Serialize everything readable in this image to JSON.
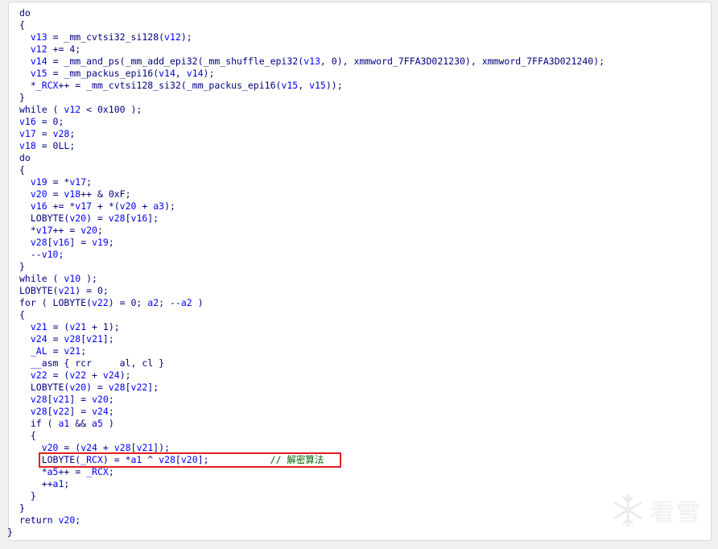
{
  "colors": {
    "keyword": "#000080",
    "variable": "#0000ff",
    "comment": "#006400",
    "highlight_border": "#e02020"
  },
  "code_lines": [
    [
      {
        "t": "do",
        "c": "k"
      }
    ],
    [
      {
        "t": "{",
        "c": "k"
      }
    ],
    [
      {
        "t": "  ",
        "c": "k"
      },
      {
        "t": "v13",
        "c": "v"
      },
      {
        "t": " = _mm_cvtsi32_si128(",
        "c": "k"
      },
      {
        "t": "v12",
        "c": "v"
      },
      {
        "t": ");",
        "c": "k"
      }
    ],
    [
      {
        "t": "  ",
        "c": "k"
      },
      {
        "t": "v12",
        "c": "v"
      },
      {
        "t": " += 4;",
        "c": "k"
      }
    ],
    [
      {
        "t": "  ",
        "c": "k"
      },
      {
        "t": "v14",
        "c": "v"
      },
      {
        "t": " = _mm_and_ps(_mm_add_epi32(_mm_shuffle_epi32(",
        "c": "k"
      },
      {
        "t": "v13",
        "c": "v"
      },
      {
        "t": ", 0), xmmword_7FFA3D021230), xmmword_7FFA3D021240);",
        "c": "k"
      }
    ],
    [
      {
        "t": "  ",
        "c": "k"
      },
      {
        "t": "v15",
        "c": "v"
      },
      {
        "t": " = _mm_packus_epi16(",
        "c": "k"
      },
      {
        "t": "v14",
        "c": "v"
      },
      {
        "t": ", ",
        "c": "k"
      },
      {
        "t": "v14",
        "c": "v"
      },
      {
        "t": ");",
        "c": "k"
      }
    ],
    [
      {
        "t": "  *",
        "c": "k"
      },
      {
        "t": "_RCX",
        "c": "v"
      },
      {
        "t": "++ = _mm_cvtsi128_si32(_mm_packus_epi16(",
        "c": "k"
      },
      {
        "t": "v15",
        "c": "v"
      },
      {
        "t": ", ",
        "c": "k"
      },
      {
        "t": "v15",
        "c": "v"
      },
      {
        "t": "));",
        "c": "k"
      }
    ],
    [
      {
        "t": "}",
        "c": "k"
      }
    ],
    [
      {
        "t": "while ( ",
        "c": "k"
      },
      {
        "t": "v12",
        "c": "v"
      },
      {
        "t": " < 0x100 );",
        "c": "k"
      }
    ],
    [
      {
        "t": "v16",
        "c": "v"
      },
      {
        "t": " = 0;",
        "c": "k"
      }
    ],
    [
      {
        "t": "v17",
        "c": "v"
      },
      {
        "t": " = ",
        "c": "k"
      },
      {
        "t": "v28",
        "c": "v"
      },
      {
        "t": ";",
        "c": "k"
      }
    ],
    [
      {
        "t": "v18",
        "c": "v"
      },
      {
        "t": " = 0LL;",
        "c": "k"
      }
    ],
    [
      {
        "t": "do",
        "c": "k"
      }
    ],
    [
      {
        "t": "{",
        "c": "k"
      }
    ],
    [
      {
        "t": "  ",
        "c": "k"
      },
      {
        "t": "v19",
        "c": "v"
      },
      {
        "t": " = *",
        "c": "k"
      },
      {
        "t": "v17",
        "c": "v"
      },
      {
        "t": ";",
        "c": "k"
      }
    ],
    [
      {
        "t": "  ",
        "c": "k"
      },
      {
        "t": "v20",
        "c": "v"
      },
      {
        "t": " = ",
        "c": "k"
      },
      {
        "t": "v18",
        "c": "v"
      },
      {
        "t": "++ & 0xF;",
        "c": "k"
      }
    ],
    [
      {
        "t": "  ",
        "c": "k"
      },
      {
        "t": "v16",
        "c": "v"
      },
      {
        "t": " += *",
        "c": "k"
      },
      {
        "t": "v17",
        "c": "v"
      },
      {
        "t": " + *(",
        "c": "k"
      },
      {
        "t": "v20",
        "c": "v"
      },
      {
        "t": " + ",
        "c": "k"
      },
      {
        "t": "a3",
        "c": "v"
      },
      {
        "t": ");",
        "c": "k"
      }
    ],
    [
      {
        "t": "  LOBYTE(",
        "c": "k"
      },
      {
        "t": "v20",
        "c": "v"
      },
      {
        "t": ") = ",
        "c": "k"
      },
      {
        "t": "v28",
        "c": "v"
      },
      {
        "t": "[",
        "c": "k"
      },
      {
        "t": "v16",
        "c": "v"
      },
      {
        "t": "];",
        "c": "k"
      }
    ],
    [
      {
        "t": "  *",
        "c": "k"
      },
      {
        "t": "v17",
        "c": "v"
      },
      {
        "t": "++ = ",
        "c": "k"
      },
      {
        "t": "v20",
        "c": "v"
      },
      {
        "t": ";",
        "c": "k"
      }
    ],
    [
      {
        "t": "  ",
        "c": "k"
      },
      {
        "t": "v28",
        "c": "v"
      },
      {
        "t": "[",
        "c": "k"
      },
      {
        "t": "v16",
        "c": "v"
      },
      {
        "t": "] = ",
        "c": "k"
      },
      {
        "t": "v19",
        "c": "v"
      },
      {
        "t": ";",
        "c": "k"
      }
    ],
    [
      {
        "t": "  --",
        "c": "k"
      },
      {
        "t": "v10",
        "c": "v"
      },
      {
        "t": ";",
        "c": "k"
      }
    ],
    [
      {
        "t": "}",
        "c": "k"
      }
    ],
    [
      {
        "t": "while ( ",
        "c": "k"
      },
      {
        "t": "v10",
        "c": "v"
      },
      {
        "t": " );",
        "c": "k"
      }
    ],
    [
      {
        "t": "LOBYTE(",
        "c": "k"
      },
      {
        "t": "v21",
        "c": "v"
      },
      {
        "t": ") = 0;",
        "c": "k"
      }
    ],
    [
      {
        "t": "for ( LOBYTE(",
        "c": "k"
      },
      {
        "t": "v22",
        "c": "v"
      },
      {
        "t": ") = 0; ",
        "c": "k"
      },
      {
        "t": "a2",
        "c": "v"
      },
      {
        "t": "; --",
        "c": "k"
      },
      {
        "t": "a2",
        "c": "v"
      },
      {
        "t": " )",
        "c": "k"
      }
    ],
    [
      {
        "t": "{",
        "c": "k"
      }
    ],
    [
      {
        "t": "  ",
        "c": "k"
      },
      {
        "t": "v21",
        "c": "v"
      },
      {
        "t": " = (",
        "c": "k"
      },
      {
        "t": "v21",
        "c": "v"
      },
      {
        "t": " + 1);",
        "c": "k"
      }
    ],
    [
      {
        "t": "  ",
        "c": "k"
      },
      {
        "t": "v24",
        "c": "v"
      },
      {
        "t": " = ",
        "c": "k"
      },
      {
        "t": "v28",
        "c": "v"
      },
      {
        "t": "[",
        "c": "k"
      },
      {
        "t": "v21",
        "c": "v"
      },
      {
        "t": "];",
        "c": "k"
      }
    ],
    [
      {
        "t": "  ",
        "c": "k"
      },
      {
        "t": "_AL",
        "c": "v"
      },
      {
        "t": " = ",
        "c": "k"
      },
      {
        "t": "v21",
        "c": "v"
      },
      {
        "t": ";",
        "c": "k"
      }
    ],
    [
      {
        "t": "  __asm { rcr     al, cl }",
        "c": "k"
      }
    ],
    [
      {
        "t": "  ",
        "c": "k"
      },
      {
        "t": "v22",
        "c": "v"
      },
      {
        "t": " = (",
        "c": "k"
      },
      {
        "t": "v22",
        "c": "v"
      },
      {
        "t": " + ",
        "c": "k"
      },
      {
        "t": "v24",
        "c": "v"
      },
      {
        "t": ");",
        "c": "k"
      }
    ],
    [
      {
        "t": "  LOBYTE(",
        "c": "k"
      },
      {
        "t": "v20",
        "c": "v"
      },
      {
        "t": ") = ",
        "c": "k"
      },
      {
        "t": "v28",
        "c": "v"
      },
      {
        "t": "[",
        "c": "k"
      },
      {
        "t": "v22",
        "c": "v"
      },
      {
        "t": "];",
        "c": "k"
      }
    ],
    [
      {
        "t": "  ",
        "c": "k"
      },
      {
        "t": "v28",
        "c": "v"
      },
      {
        "t": "[",
        "c": "k"
      },
      {
        "t": "v21",
        "c": "v"
      },
      {
        "t": "] = ",
        "c": "k"
      },
      {
        "t": "v20",
        "c": "v"
      },
      {
        "t": ";",
        "c": "k"
      }
    ],
    [
      {
        "t": "  ",
        "c": "k"
      },
      {
        "t": "v28",
        "c": "v"
      },
      {
        "t": "[",
        "c": "k"
      },
      {
        "t": "v22",
        "c": "v"
      },
      {
        "t": "] = ",
        "c": "k"
      },
      {
        "t": "v24",
        "c": "v"
      },
      {
        "t": ";",
        "c": "k"
      }
    ],
    [
      {
        "t": "  if ( ",
        "c": "k"
      },
      {
        "t": "a1",
        "c": "v"
      },
      {
        "t": " && ",
        "c": "k"
      },
      {
        "t": "a5",
        "c": "v"
      },
      {
        "t": " )",
        "c": "k"
      }
    ],
    [
      {
        "t": "  {",
        "c": "k"
      }
    ],
    [
      {
        "t": "    ",
        "c": "k"
      },
      {
        "t": "v20",
        "c": "v"
      },
      {
        "t": " = (",
        "c": "k"
      },
      {
        "t": "v24",
        "c": "v"
      },
      {
        "t": " + ",
        "c": "k"
      },
      {
        "t": "v28",
        "c": "v"
      },
      {
        "t": "[",
        "c": "k"
      },
      {
        "t": "v21",
        "c": "v"
      },
      {
        "t": "]);",
        "c": "k"
      }
    ],
    [
      {
        "t": "    LOBYTE(",
        "c": "k"
      },
      {
        "t": "_RCX",
        "c": "v"
      },
      {
        "t": ") = *",
        "c": "k"
      },
      {
        "t": "a1",
        "c": "v"
      },
      {
        "t": " ^ ",
        "c": "k"
      },
      {
        "t": "v28",
        "c": "v"
      },
      {
        "t": "[",
        "c": "k"
      },
      {
        "t": "v20",
        "c": "v"
      },
      {
        "t": "];           ",
        "c": "k"
      },
      {
        "t": "// 解密算法",
        "c": "cm"
      }
    ],
    [
      {
        "t": "    *",
        "c": "k"
      },
      {
        "t": "a5",
        "c": "v"
      },
      {
        "t": "++ = ",
        "c": "k"
      },
      {
        "t": "_RCX",
        "c": "v"
      },
      {
        "t": ";",
        "c": "k"
      }
    ],
    [
      {
        "t": "    ++",
        "c": "k"
      },
      {
        "t": "a1",
        "c": "v"
      },
      {
        "t": ";",
        "c": "k"
      }
    ],
    [
      {
        "t": "  }",
        "c": "k"
      }
    ],
    [
      {
        "t": "}",
        "c": "k"
      }
    ],
    [
      {
        "t": "return ",
        "c": "k"
      },
      {
        "t": "v20",
        "c": "v"
      },
      {
        "t": ";",
        "c": "k"
      }
    ],
    [
      {
        "t": "}",
        "c": "k"
      }
    ]
  ],
  "highlight_line_index": 37,
  "watermark": {
    "icon": "snowflake-icon",
    "text": "看雪"
  }
}
